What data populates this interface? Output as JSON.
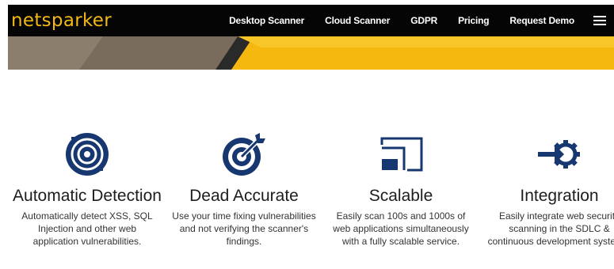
{
  "brand": {
    "logo_text": "netsparker"
  },
  "nav": {
    "items": [
      "Desktop Scanner",
      "Cloud Scanner",
      "GDPR",
      "Pricing",
      "Request Demo"
    ],
    "menu_icon": "hamburger-icon"
  },
  "colors": {
    "accent": "#f2b916",
    "icon_navy": "#16376f",
    "header_bg": "#050505"
  },
  "features": [
    {
      "icon": "target-scan-icon",
      "title": "Automatic Detection",
      "desc": "Automatically detect XSS, SQL Injection and other web application vulnerabilities."
    },
    {
      "icon": "bullseye-arrow-icon",
      "title": "Dead Accurate",
      "desc": "Use your time fixing vulnerabilities and not verifying the scanner's findings."
    },
    {
      "icon": "scale-screens-icon",
      "title": "Scalable",
      "desc": "Easily scan 100s and 1000s of web applications simultaneously with a fully scalable service."
    },
    {
      "icon": "arrow-gear-icon",
      "title": "Integration",
      "desc": "Easily integrate web security scanning in the SDLC & continuous development systems."
    }
  ]
}
